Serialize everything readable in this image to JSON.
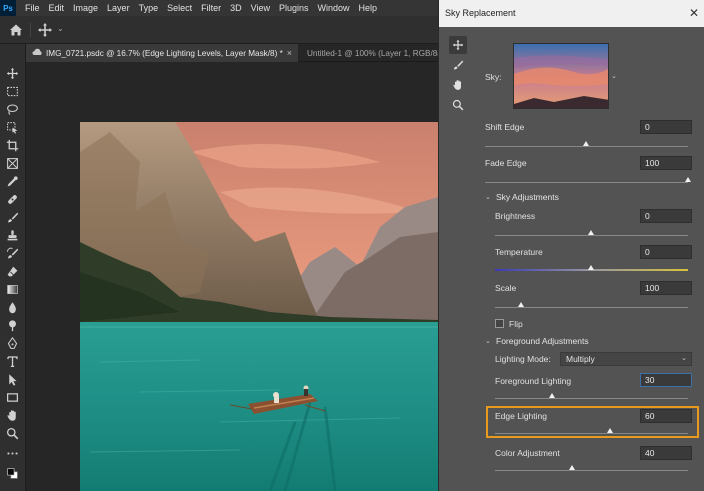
{
  "menubar": {
    "logo": "Ps",
    "items": [
      "File",
      "Edit",
      "Image",
      "Layer",
      "Type",
      "Select",
      "Filter",
      "3D",
      "View",
      "Plugins",
      "Window",
      "Help"
    ]
  },
  "tabs": [
    {
      "label": "IMG_0721.psdc @ 16.7% (Edge Lighting Levels, Layer Mask/8) *",
      "close": "×"
    },
    {
      "label": "Untitled-1 @ 100% (Layer 1, RGB/8#"
    }
  ],
  "tools": [
    "move-icon",
    "marquee-icon",
    "lasso-icon",
    "object-select-icon",
    "crop-icon",
    "frame-icon",
    "eyedropper-icon",
    "healing-icon",
    "brush-icon",
    "stamp-icon",
    "history-brush-icon",
    "eraser-icon",
    "gradient-icon",
    "blur-icon",
    "dodge-icon",
    "pen-icon",
    "type-icon",
    "path-select-icon",
    "rectangle-icon",
    "hand-icon",
    "zoom-icon",
    "more-icon",
    "color-swatches-icon"
  ],
  "dialog": {
    "title": "Sky Replacement",
    "close": "✕",
    "tools": [
      "move-sky-icon",
      "sky-brush-icon",
      "hand-icon",
      "zoom-icon"
    ],
    "sky_label": "Sky:",
    "fields": {
      "shift_edge": {
        "label": "Shift Edge",
        "value": "0",
        "slider": 0.5
      },
      "fade_edge": {
        "label": "Fade Edge",
        "value": "100",
        "slider": 1.0
      },
      "brightness": {
        "label": "Brightness",
        "value": "0",
        "slider": 0.5
      },
      "temperature": {
        "label": "Temperature",
        "value": "0",
        "slider": 0.5
      },
      "scale": {
        "label": "Scale",
        "value": "100",
        "slider": 0.135
      },
      "foreground_lighting": {
        "label": "Foreground Lighting",
        "value": "30",
        "slider": 0.3
      },
      "edge_lighting": {
        "label": "Edge Lighting",
        "value": "60",
        "slider": 0.6
      },
      "color_adjustment": {
        "label": "Color Adjustment",
        "value": "40",
        "slider": 0.4
      }
    },
    "sky_adjustments_label": "Sky Adjustments",
    "foreground_adjustments_label": "Foreground Adjustments",
    "flip_label": "Flip",
    "flip_checked": false,
    "lighting_mode_label": "Lighting Mode:",
    "lighting_mode_value": "Multiply",
    "highlight_color": "#e89a1e"
  }
}
